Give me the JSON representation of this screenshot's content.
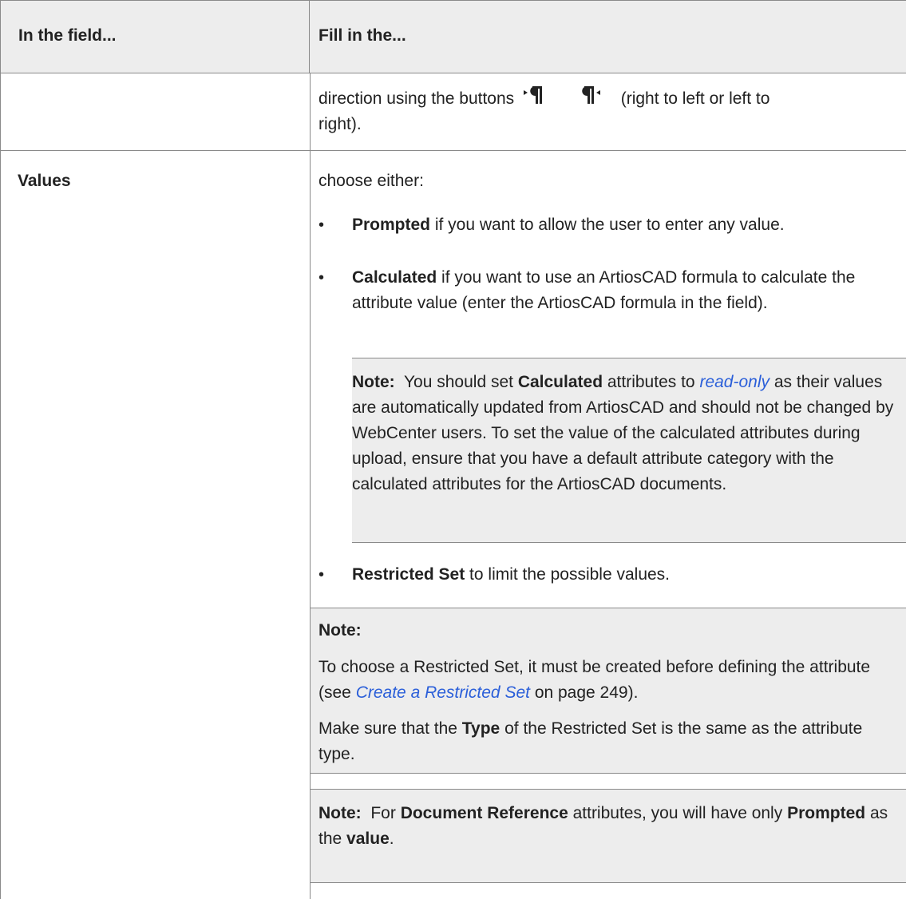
{
  "table": {
    "header": {
      "col1": "In the field...",
      "col2": "Fill in the..."
    },
    "row1": {
      "text_before_icons": "direction using the buttons",
      "icons": [
        "paragraph-rtl-icon",
        "paragraph-ltr-icon"
      ],
      "text_after_icons": "(right to left or left to right).",
      "line1_tail": "(right to left or left to",
      "line2": "right)."
    },
    "row2": {
      "field": "Values",
      "intro": "choose either:",
      "bullets": [
        {
          "bold": "Prompted",
          "rest": " if you want to allow the user to enter any value."
        },
        {
          "bold": "Calculated",
          "rest": " if you want to use an ArtiosCAD formula to calculate the attribute value (enter the ArtiosCAD formula in the field)."
        },
        {
          "bold": "Restricted Set",
          "rest": " to limit the possible values."
        }
      ],
      "note_calculated": {
        "label": "Note:",
        "text1": "You should set",
        "bold1": "Calculated",
        "text2": "attributes to",
        "link": "read-only",
        "text3": "as their values are automatically updated from ArtiosCAD and should not be changed by WebCenter users. To set the value of the calculated attributes during upload, ensure that you have a default attribute category with the calculated attributes for the ArtiosCAD documents."
      },
      "note_restricted": {
        "label": "Note:",
        "para1_a": "To choose a Restricted Set, it must be created before defining the attribute (see",
        "para1_link": "Create a Restricted Set",
        "para1_b": "on page 249).",
        "para2_a": "Make sure that the",
        "para2_bold": "Type",
        "para2_b": "of the Restricted Set is the same as the attribute type."
      },
      "note_document": {
        "label": "Note:",
        "text1": "For",
        "bold1": "Document Reference",
        "text2": "attributes, you will have only",
        "bold2": "Prompted",
        "text3": "as the",
        "bold3": "value",
        "text4": "."
      }
    }
  },
  "colors": {
    "header_bg": "#ededed",
    "note_bg": "#ededed",
    "border": "#8a8a8a",
    "link": "#2b5fd9",
    "text": "#222222"
  }
}
